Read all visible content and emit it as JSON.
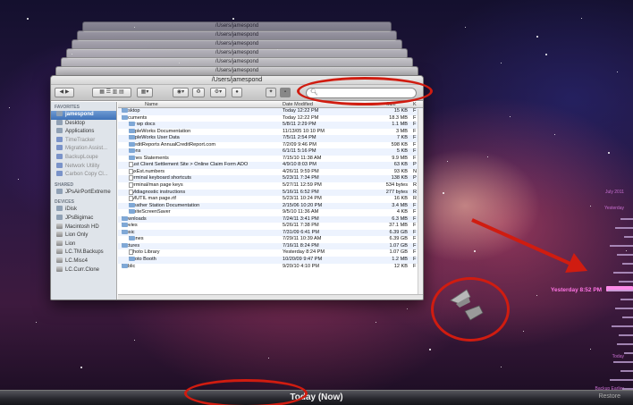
{
  "window": {
    "title": "/Users/jamespond",
    "ghost_titles": [
      "/Users/jamespond",
      "/Users/jamespond",
      "/Users/jamespond",
      "/Users/jamespond",
      "/Users/jamespond",
      "/Users/jamespond"
    ],
    "search_placeholder": ""
  },
  "sidebar": {
    "favorites_header": "FAVORITES",
    "favorites": [
      {
        "label": "jamespond",
        "selected": true,
        "icon": "home-icon"
      },
      {
        "label": "Desktop",
        "icon": "desktop-icon"
      },
      {
        "label": "Applications",
        "icon": "applications-icon"
      },
      {
        "label": "TimeTracker",
        "dim": true,
        "icon": "app-icon"
      },
      {
        "label": "Migration Assist...",
        "dim": true,
        "icon": "app-icon"
      },
      {
        "label": "BackupLoupe",
        "dim": true,
        "icon": "app-icon"
      },
      {
        "label": "Network Utility",
        "dim": true,
        "icon": "app-icon"
      },
      {
        "label": "Carbon Copy Cl...",
        "dim": true,
        "icon": "app-icon"
      }
    ],
    "shared_header": "SHARED",
    "shared": [
      {
        "label": "JPsAirPortExtreme",
        "icon": "network-icon"
      }
    ],
    "devices_header": "DEVICES",
    "devices": [
      {
        "label": "iDisk",
        "icon": "idisk-icon"
      },
      {
        "label": "JPsBigimac",
        "icon": "computer-icon"
      },
      {
        "label": "Macintosh HD",
        "icon": "drive-icon"
      },
      {
        "label": "Lion Only",
        "icon": "drive-icon"
      },
      {
        "label": "Lion",
        "icon": "drive-icon"
      },
      {
        "label": "LC.TM.Backups",
        "icon": "drive-icon"
      },
      {
        "label": "LC.Misc4",
        "icon": "drive-icon"
      },
      {
        "label": "LC.Curr.Clone",
        "icon": "drive-icon"
      }
    ]
  },
  "columns": {
    "name": "Name",
    "date": "Date Modified",
    "size": "Size",
    "kind": "K"
  },
  "files": [
    {
      "name": "Desktop",
      "date": "Today 12:22 PM",
      "size": "15 KB",
      "kind": "F",
      "indent": 0,
      "type": "folder",
      "tri": "closed"
    },
    {
      "name": "Documents",
      "date": "Today 12:22 PM",
      "size": "18.3 MB",
      "kind": "F",
      "indent": 0,
      "type": "folder",
      "tri": "open"
    },
    {
      "name": "My wp docs",
      "date": "5/8/11 2:29 PM",
      "size": "1.1 MB",
      "kind": "F",
      "indent": 1,
      "type": "folder",
      "tri": "closed"
    },
    {
      "name": "AppleWorks Documentation",
      "date": "11/13/05 10:10 PM",
      "size": "3 MB",
      "kind": "F",
      "indent": 1,
      "type": "folder",
      "tri": "closed"
    },
    {
      "name": "AppleWorks User Data",
      "date": "7/5/11 2:54 PM",
      "size": "7 KB",
      "kind": "F",
      "indent": 1,
      "type": "folder",
      "tri": "closed"
    },
    {
      "name": "CreditReports AnnualCreditReport.com",
      "date": "7/2/09 9:46 PM",
      "size": "598 KB",
      "kind": "F",
      "indent": 1,
      "type": "folder",
      "tri": "closed"
    },
    {
      "name": "Icons",
      "date": "6/1/11 5:16 PM",
      "size": "5 KB",
      "kind": "F",
      "indent": 1,
      "type": "folder",
      "tri": "closed"
    },
    {
      "name": "Jones Statements",
      "date": "7/15/10 11:38 AM",
      "size": "9.9 MB",
      "kind": "F",
      "indent": 1,
      "type": "folder",
      "tri": "closed"
    },
    {
      "name": "Rust Client Settlement Site > Online Claim Form ADO",
      "date": "4/9/10 8:03 PM",
      "size": "63 KB",
      "kind": "P",
      "indent": 1,
      "type": "doc",
      "tri": "none"
    },
    {
      "name": "TaxEst.numbers",
      "date": "4/26/11 9:59 PM",
      "size": "93 KB",
      "kind": "N",
      "indent": 1,
      "type": "doc",
      "tri": "none"
    },
    {
      "name": "Terminal keyboard shortcuts",
      "date": "5/23/11 7:34 PM",
      "size": "138 KB",
      "kind": "P",
      "indent": 1,
      "type": "doc",
      "tri": "none"
    },
    {
      "name": "Terminal/man page keys",
      "date": "5/27/11 12:59 PM",
      "size": "534 bytes",
      "kind": "R",
      "indent": 1,
      "type": "doc",
      "tri": "none"
    },
    {
      "name": "TMdiagnostic instructions",
      "date": "5/16/11 6:52 PM",
      "size": "277 bytes",
      "kind": "R",
      "indent": 1,
      "type": "doc",
      "tri": "none"
    },
    {
      "name": "TMUTIL man page.rtf",
      "date": "5/23/11 10:24 PM",
      "size": "16 KB",
      "kind": "R",
      "indent": 1,
      "type": "doc",
      "tri": "none"
    },
    {
      "name": "Weather Station Documentation",
      "date": "2/15/06 10:20 PM",
      "size": "3.4 MB",
      "kind": "F",
      "indent": 1,
      "type": "folder",
      "tri": "closed"
    },
    {
      "name": "WhiteScreenSaver",
      "date": "9/5/10 11:36 AM",
      "size": "4 KB",
      "kind": "F",
      "indent": 1,
      "type": "folder",
      "tri": "closed"
    },
    {
      "name": "Downloads",
      "date": "7/24/11 3:41 PM",
      "size": "6.3 MB",
      "kind": "F",
      "indent": 0,
      "type": "folder",
      "tri": "closed"
    },
    {
      "name": "Movies",
      "date": "5/26/11 7:38 PM",
      "size": "37.1 MB",
      "kind": "F",
      "indent": 0,
      "type": "folder",
      "tri": "closed"
    },
    {
      "name": "Music",
      "date": "7/31/09 6:41 PM",
      "size": "6.39 GB",
      "kind": "F",
      "indent": 0,
      "type": "folder",
      "tri": "open"
    },
    {
      "name": "iTunes",
      "date": "7/29/11 10:39 AM",
      "size": "6.39 GB",
      "kind": "F",
      "indent": 1,
      "type": "folder",
      "tri": "closed"
    },
    {
      "name": "Pictures",
      "date": "7/16/11 8:24 PM",
      "size": "1.07 GB",
      "kind": "F",
      "indent": 0,
      "type": "folder",
      "tri": "open"
    },
    {
      "name": "iPhoto Library",
      "date": "Yesterday 8:24 PM",
      "size": "1.07 GB",
      "kind": "F",
      "indent": 1,
      "type": "doc",
      "tri": "none"
    },
    {
      "name": "Photo Booth",
      "date": "10/20/09 9:47 PM",
      "size": "1.2 MB",
      "kind": "F",
      "indent": 1,
      "type": "folder",
      "tri": "closed"
    },
    {
      "name": "Public",
      "date": "9/20/10 4:10 PM",
      "size": "12 KB",
      "kind": "F",
      "indent": 0,
      "type": "folder",
      "tri": "closed"
    }
  ],
  "timeline": {
    "top_label": "July 2011",
    "yesterday_label": "Yesterday",
    "now_label": "Yesterday 8:52 PM",
    "today_label": "Today",
    "bottom_label": "Backup Earlier"
  },
  "bottom_bar": {
    "today_now": "Today (Now)",
    "restore": "Restore"
  },
  "colors": {
    "annotation_red": "#d01c10",
    "timeline_pink": "#ff74e4",
    "selection_blue": "#3f72b8"
  }
}
